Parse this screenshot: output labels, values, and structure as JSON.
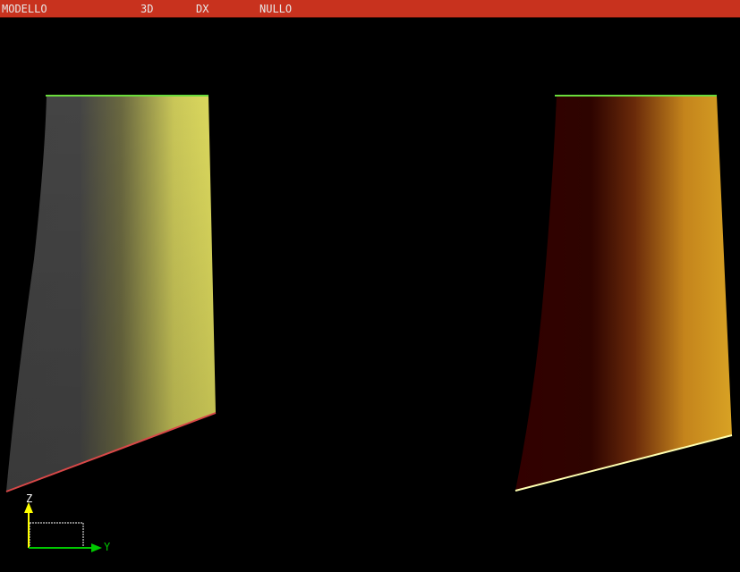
{
  "menu": {
    "model": "MODELLO",
    "view": "3D",
    "side": "DX",
    "status": "NULLO"
  },
  "axes": {
    "vertical_label": "Z",
    "horizontal_label": "Y"
  },
  "colors": {
    "background": "#000000",
    "menu_bar": "#c8321e",
    "menu_text": "#e8e8e8",
    "axis_color": "#ffff00",
    "y_axis_color": "#00c800",
    "left_panel_dark": "#3a3a3a",
    "left_panel_light": "#d8d458",
    "right_panel_dark": "#1c0000",
    "right_panel_light": "#d49a20",
    "top_edge": "#6adc3c",
    "left_bottom_edge": "#d84848",
    "right_bottom_edge": "#ffffb0"
  }
}
